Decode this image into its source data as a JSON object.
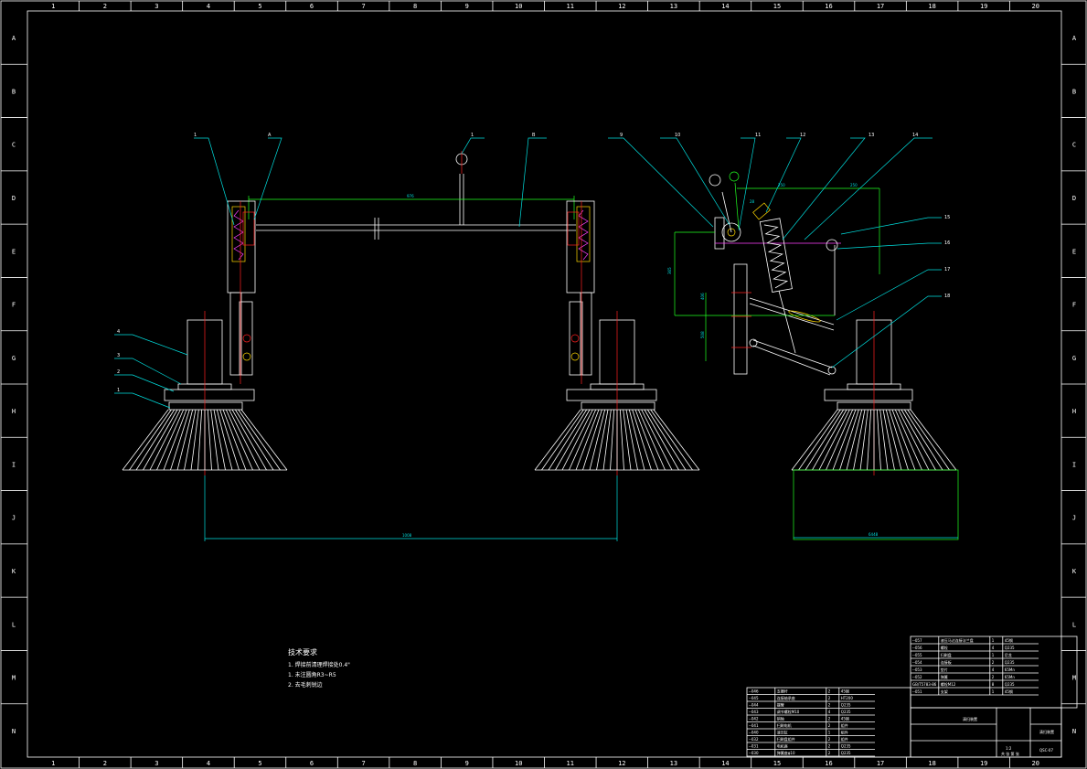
{
  "frame": {
    "columns": [
      "1",
      "2",
      "3",
      "4",
      "5",
      "6",
      "7",
      "8",
      "9",
      "10",
      "11",
      "12",
      "13",
      "14",
      "15",
      "16",
      "17",
      "18",
      "19",
      "20"
    ],
    "rows": [
      "A",
      "B",
      "C",
      "D",
      "E",
      "F",
      "G",
      "H",
      "I",
      "J",
      "K",
      "L",
      "M",
      "N"
    ]
  },
  "colors": {
    "background": "#000000",
    "outline": "#ffffff",
    "leader": "#00e0e0",
    "center": "#ff2020",
    "dimension": "#20ff20",
    "highlight": "#ffd700",
    "spring": "#ff40ff"
  },
  "callouts": {
    "left_view": [
      "1",
      "A",
      "1",
      "B"
    ],
    "left_side": [
      "4",
      "3",
      "2",
      "1"
    ],
    "right_view": [
      "9",
      "10",
      "11",
      "12",
      "13",
      "14",
      "15",
      "16",
      "17",
      "18"
    ]
  },
  "dimensions": {
    "top_span": "976",
    "bottom_span": "1008",
    "right_width": "6448",
    "right_h1": "365",
    "right_h2": "406",
    "right_h3": "508",
    "right_top": "250",
    "right_a": "250",
    "right_b": "28"
  },
  "notes": {
    "title": "技术要求",
    "items": [
      "1. 焊接前清理焊接处0.4\"",
      "1. 未注圆角R3~R5",
      "2. 去毛刺锐边"
    ]
  },
  "title_block": {
    "drawing_name": "清扫装置",
    "drawing_no": "QSC-07",
    "scale": "1:2",
    "sheet": "共 张 第 张"
  },
  "parts_list_upper": [
    {
      "no": "--057",
      "name": "液压马达连接法兰盘",
      "qty": "1",
      "material": "45钢"
    },
    {
      "no": "--056",
      "name": "螺栓",
      "qty": "4",
      "material": "Q235"
    },
    {
      "no": "--055",
      "name": "扫刷盘",
      "qty": "1",
      "material": "尼龙"
    },
    {
      "no": "--054",
      "name": "连接板",
      "qty": "2",
      "material": "Q235"
    },
    {
      "no": "--053",
      "name": "垫片",
      "qty": "4",
      "material": "65Mn"
    },
    {
      "no": "--052",
      "name": "弹簧",
      "qty": "2",
      "material": "65Mn"
    },
    {
      "no": "GB/T5783-86",
      "name": "螺栓M12",
      "qty": "8",
      "material": "Q235"
    },
    {
      "no": "--051",
      "name": "支架",
      "qty": "1",
      "material": "45钢"
    }
  ],
  "parts_list_lower": [
    {
      "no": "--046",
      "name": "支撑杆",
      "qty": "2",
      "material": "45钢"
    },
    {
      "no": "--045",
      "name": "连接轴承座",
      "qty": "2",
      "material": "HT200"
    },
    {
      "no": "--044",
      "name": "摆臂",
      "qty": "2",
      "material": "Q235"
    },
    {
      "no": "--043",
      "name": "调节螺栓M10",
      "qty": "4",
      "material": "Q235"
    },
    {
      "no": "--042",
      "name": "销轴",
      "qty": "2",
      "material": "45钢"
    },
    {
      "no": "--041",
      "name": "扫刷电机",
      "qty": "2",
      "material": "组件"
    },
    {
      "no": "--040",
      "name": "液压缸",
      "qty": "1",
      "material": "组件"
    },
    {
      "no": "--032",
      "name": "扫刷盘组件",
      "qty": "2",
      "material": "组件"
    },
    {
      "no": "--031",
      "name": "电机座",
      "qty": "2",
      "material": "Q235"
    },
    {
      "no": "--030",
      "name": "弹簧座φ10",
      "qty": "2",
      "material": "Q235"
    }
  ]
}
